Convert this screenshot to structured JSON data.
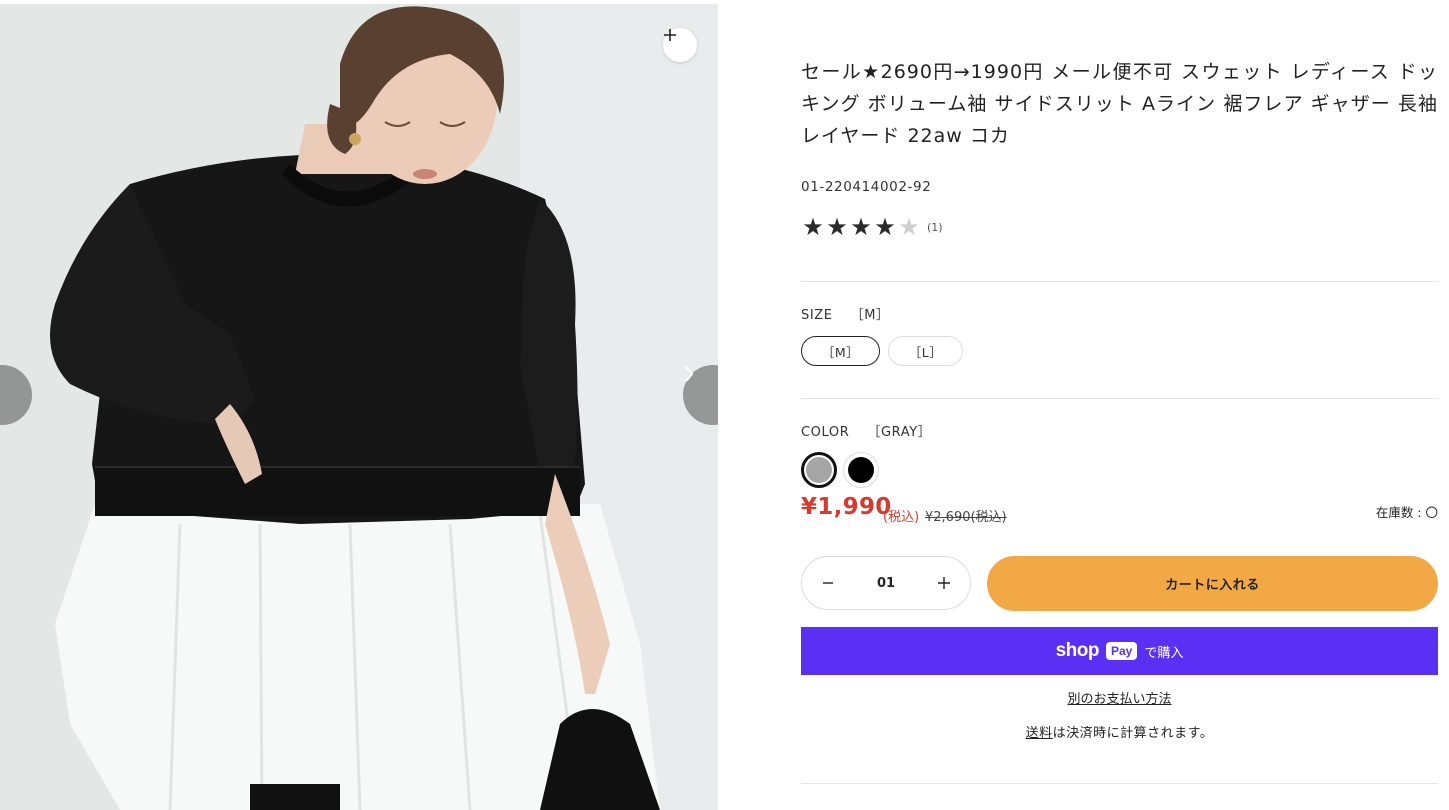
{
  "product": {
    "title": "セール★2690円→1990円 メール便不可 スウェット レディース ドッキング ボリューム袖 サイドスリット Aライン 裾フレア ギャザー 長袖 レイヤード 22aw コカ",
    "sku": "01-220414002-92",
    "rating": {
      "value": 4,
      "max": 5,
      "count_label": "(1)"
    }
  },
  "gallery": {
    "zoom_label": "+",
    "prev_icon": "chevron-left-icon",
    "next_icon": "chevron-right-icon",
    "image_subject": "model-wearing-black-sweatshirt-with-white-peplum-hem"
  },
  "size": {
    "label": "SIZE",
    "selected": "［M］",
    "options": [
      "［M］",
      "［L］"
    ]
  },
  "color": {
    "label": "COLOR",
    "selected": "［GRAY］",
    "options": [
      {
        "name": "GRAY",
        "hex": "#a5a5a5"
      },
      {
        "name": "BLACK",
        "hex": "#000000"
      }
    ]
  },
  "price": {
    "current": "¥1,990",
    "tax_label": "(税込)",
    "original": "¥2,690(税込)",
    "stock_label": "在庫数 : 〇"
  },
  "cart": {
    "quantity": "01",
    "add_to_cart": "カートに入れる"
  },
  "shop_pay": {
    "word": "shop",
    "badge": "Pay",
    "buy_label": "で購入"
  },
  "payment": {
    "alt_methods": "別のお支払い方法",
    "shipping_link": "送料",
    "shipping_note": "は決済時に計算されます。"
  },
  "colors": {
    "price_red": "#d63b2f",
    "cart_orange": "#f2a945",
    "shoppay_purple": "#5a31f4"
  }
}
